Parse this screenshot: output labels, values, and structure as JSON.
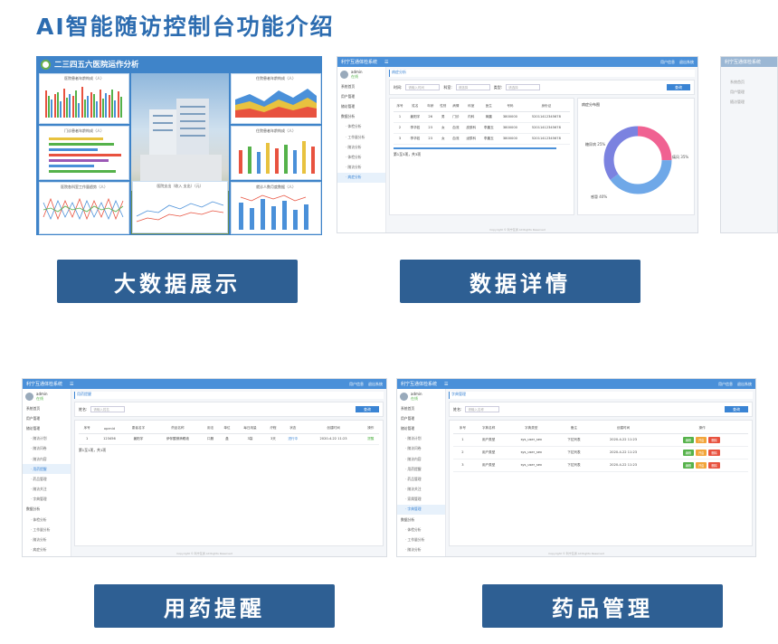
{
  "page_title": "AI智能随访控制台功能介绍",
  "captions": {
    "c1": "大数据展示",
    "c2": "数据详情",
    "c3": "用药提醒",
    "c4": "药品管理"
  },
  "app": {
    "name": "利宁互通体检系统",
    "user": "admin",
    "status": "在线",
    "logout": "注销",
    "personal": "用户信息",
    "exit": "退出系统",
    "copyright": "Copyright © 利宁互通 All Rights Reserved"
  },
  "dash": {
    "title": "二三四五六医院运作分析",
    "p1": "医院患者年龄构成（人）",
    "p2": "门诊患者年龄构成（人）",
    "p3": "医院各科室工作量趋势（人）",
    "p4": "住院患者年龄构成（人）",
    "p5": "住院患者年龄构成（人）",
    "p6": "医院支出（收入 支出）（元）",
    "p7": "就诊人数月度数据（人）"
  },
  "detail": {
    "crumb": "病症分析",
    "f_time": "时间:",
    "f_time_ph": "请输入时间",
    "f_dept": "科室:",
    "f_dept_ph": "请选择",
    "f_type": "类型:",
    "f_type_ph": "请选择",
    "search": "查询",
    "cols": [
      "序号",
      "姓名",
      "年龄",
      "性别",
      "病情",
      "科室",
      "医生",
      "号码",
      "身份证"
    ],
    "rows": [
      [
        "1",
        "姜阳宇",
        "26",
        "男",
        "门诊",
        "内科",
        "蒋晨",
        "3800000",
        "52011412345678"
      ],
      [
        "2",
        "李华若",
        "23",
        "女",
        "血流",
        "皮肤科",
        "李晨玉",
        "3800000",
        "52011412345678"
      ],
      [
        "3",
        "李华若",
        "23",
        "女",
        "血流",
        "泌尿科",
        "李晨玉",
        "3800000",
        "52011412345678"
      ]
    ],
    "total": "第1至3项，共3项",
    "chart_title": "病症分布图",
    "legend": [
      "糖尿病 25%",
      "感冒 40%",
      "痛风 35%"
    ],
    "menu": [
      "系统首页",
      "用户管理",
      "随访管理",
      "数据分析",
      "· 体检分析",
      "· 工作量分析",
      "· 随访分析",
      "· 体检分析",
      "· 随访分析",
      "· 病症分析"
    ]
  },
  "med": {
    "crumb": "用药提醒",
    "f_name": "姓名:",
    "f_name_ph": "请输入姓名",
    "search": "查询",
    "cols": [
      "序号",
      "openid",
      "患者名字",
      "药品名称",
      "用法",
      "单位",
      "每日用量",
      "疗程",
      "状态",
      "创建时间",
      "操作"
    ],
    "row": [
      "1",
      "123456",
      "姜阳宇",
      "伊伴酸镁滴眼液",
      "口服",
      "盒",
      "3袋",
      "3天",
      "进行中",
      "2020-4-22 11:23",
      "提醒"
    ],
    "total": "第1至1项，共1项",
    "menu": [
      "系统首页",
      "用户管理",
      "随访管理",
      "· 随访计划",
      "· 随访问卷",
      "· 随访内容",
      "· 用药提醒",
      "· 药品管理",
      "· 随访关注",
      "· 字典管理",
      "数据分析",
      "· 体检分析",
      "· 工作量分析",
      "· 随访分析",
      "· 病症分析"
    ]
  },
  "drug": {
    "crumb": "字典管理",
    "f_name": "姓名:",
    "f_name_ph": "请输入名称",
    "search": "查询",
    "cols": [
      "序号",
      "字典名称",
      "字典类型",
      "备注",
      "创建时间",
      "操作"
    ],
    "rows": [
      [
        "1",
        "用户类型",
        "sys_user_sex",
        "下拉列表",
        "2020-4-22 11:23"
      ],
      [
        "2",
        "用户类型",
        "sys_user_sex",
        "下拉列表",
        "2020-4-22 11:23"
      ],
      [
        "3",
        "用户类型",
        "sys_user_sex",
        "下拉列表",
        "2020-4-22 11:23"
      ]
    ],
    "ops": [
      "编辑",
      "开启",
      "删除"
    ],
    "menu": [
      "系统首页",
      "用户管理",
      "随访管理",
      "· 随访计划",
      "· 随访问卷",
      "· 随访内容",
      "· 用药提醒",
      "· 药品管理",
      "· 随访关注",
      "· 家属管理",
      "· 字典管理",
      "数据分析",
      "· 体检分析",
      "· 工作量分析",
      "· 随访分析",
      "· 病症分析"
    ]
  },
  "colors": {
    "blue": "#3a84d4",
    "caption": "#2e5f93",
    "title": "#2c6cb0"
  }
}
